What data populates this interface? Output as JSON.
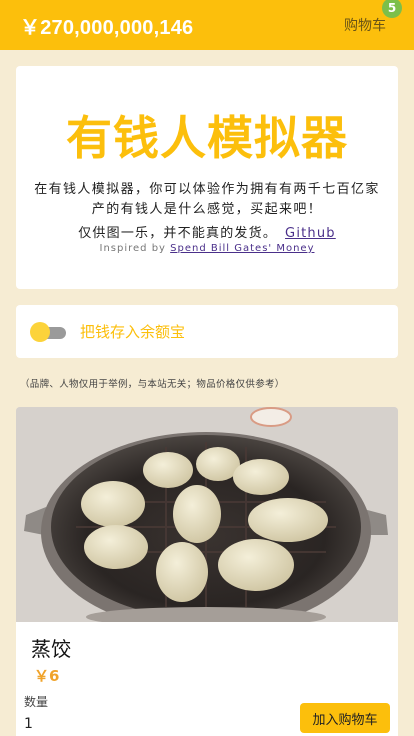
{
  "header": {
    "balance": "￥270,000,000,146",
    "cart_label": "购物车",
    "cart_count": "5"
  },
  "hero": {
    "title": "有钱人模拟器",
    "description": "在有钱人模拟器，你可以体验作为拥有有两千七百亿家产的有钱人是什么感觉，买起来吧！",
    "sub_text": "仅供图一乐，并不能真的发货。",
    "github_link": "Github",
    "credit_prefix": "Inspired by ",
    "credit_link": "Spend Bill Gates' Money"
  },
  "savings_toggle": {
    "label": "把钱存入余额宝",
    "on": false
  },
  "disclaimer": "（品牌、人物仅用于举例，与本站无关；物品价格仅供参考）",
  "products": [
    {
      "image": "steamed-dumplings-photo",
      "name": "蒸饺",
      "price": "￥6",
      "qty_label": "数量",
      "qty_value": "1",
      "add_label": "加入购物车"
    }
  ],
  "colors": {
    "accent": "#fcbf0c",
    "background": "#f6ecd3",
    "badge": "#7cbf4a",
    "link": "#4a2f8a",
    "price": "#f0a32a"
  }
}
